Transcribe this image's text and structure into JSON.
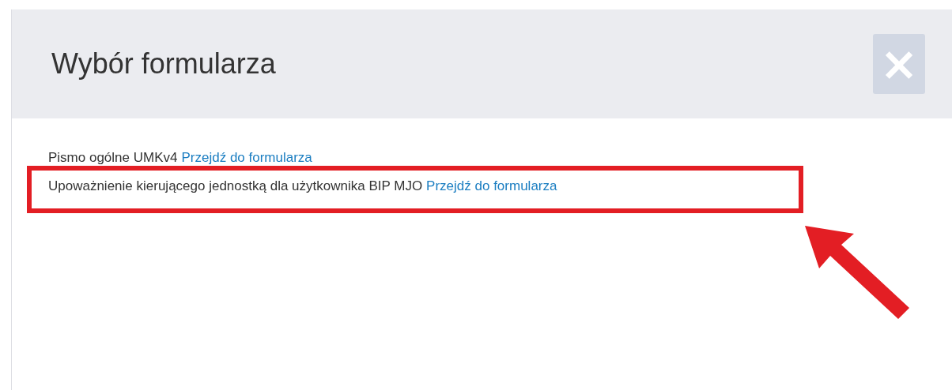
{
  "dialog": {
    "title": "Wybór formularza",
    "close": "×"
  },
  "items": [
    {
      "label": "Pismo ogólne UMKv4",
      "link": "Przejdź do formularza",
      "highlighted": false
    },
    {
      "label": "Upoważnienie kierującego jednostką dla użytkownika BIP MJO",
      "link": "Przejdź do formularza",
      "highlighted": true
    }
  ]
}
